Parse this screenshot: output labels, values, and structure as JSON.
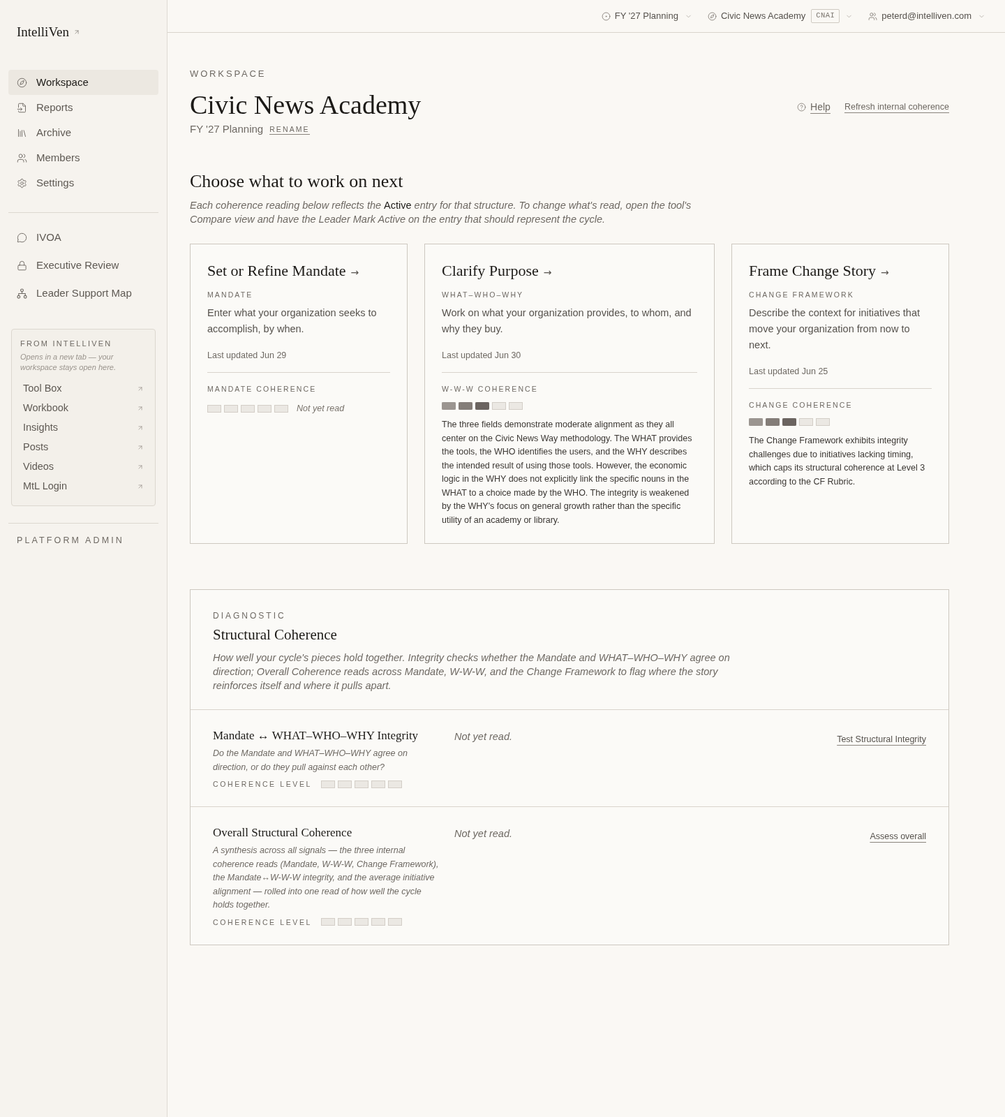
{
  "topbar": {
    "cycle": "FY '27 Planning",
    "org": {
      "name": "Civic News Academy",
      "code": "CNAI"
    },
    "user": "peterd@intelliven.com"
  },
  "sidebar": {
    "logo": "IntelliVen",
    "nav": [
      {
        "label": "Workspace",
        "selected": true
      },
      {
        "label": "Reports",
        "selected": false
      },
      {
        "label": "Archive",
        "selected": false
      },
      {
        "label": "Members",
        "selected": false
      },
      {
        "label": "Settings",
        "selected": false
      }
    ],
    "tools": [
      {
        "label": "IVOA",
        "selected": false
      },
      {
        "label": "Executive Review",
        "selected": false
      },
      {
        "label": "Leader Support Map",
        "selected": false
      }
    ],
    "external": {
      "title": "FROM INTELLIVEN",
      "note": "Opens in a new tab — your workspace stays open here.",
      "links": [
        "Tool Box",
        "Workbook",
        "Insights",
        "Posts",
        "Videos",
        "MtL Login"
      ]
    },
    "admin": "PLATFORM ADMIN"
  },
  "header": {
    "eyebrow": "WORKSPACE",
    "title": "Civic News Academy",
    "cycle": "FY '27 Planning",
    "rename": "RENAME",
    "help": "Help",
    "refresh": "Refresh internal coherence"
  },
  "next": {
    "title": "Choose what to work on next",
    "intro": "Each coherence reading below reflects the **Active** entry for that structure. To change what's read, open the tool's Compare view and have the Leader Mark Active on the entry that should represent the cycle.",
    "cards": [
      {
        "title": "Set or Refine Mandate",
        "arrow": "→",
        "eyebrow": "MANDATE",
        "description": "Enter what your organization seeks to accomplish, by when.",
        "updated": "Last updated Jun 29",
        "coherence": {
          "label": "MANDATE COHERENCE",
          "status": "Not yet read"
        }
      },
      {
        "title": "Clarify Purpose",
        "arrow": "→",
        "eyebrow": "WHAT–WHO–WHY",
        "description": "Work on what your organization provides, to whom, and why they buy.",
        "updated": "Last updated Jun 30",
        "coherence": {
          "label": "W-W-W COHERENCE",
          "level": 0.6,
          "summary": "The three fields demonstrate moderate alignment as they all center on the Civic News Way methodology. The WHAT provides the tools, the WHO identifies the users, and the WHY describes the intended result of using those tools. However, the economic logic in the WHY does not explicitly link the specific nouns in the WHAT to a choice made by the WHO. The integrity is weakened by the WHY's focus on general growth rather than the specific utility of an academy or library."
        }
      },
      {
        "title": "Frame Change Story",
        "arrow": "→",
        "eyebrow": "CHANGE FRAMEWORK",
        "description": "Describe the context for initiatives that move your organization from now to next.",
        "updated": "Last updated Jun 25",
        "coherence": {
          "label": "CHANGE COHERENCE",
          "level": 0.6,
          "summary": "The Change Framework exhibits integrity challenges due to initiatives lacking timing, which caps its structural coherence at Level 3 according to the CF Rubric."
        }
      }
    ]
  },
  "diagnostic": {
    "eyebrow": "DIAGNOSTIC",
    "title": "Structural Coherence",
    "description": "How well your cycle's pieces hold together. Integrity checks whether the Mandate and WHAT–WHO–WHY agree on direction; Overall Coherence reads across Mandate, W-W-W, and the Change Framework to flag where the story reinforces itself and where it pulls apart.",
    "rows": [
      {
        "title": "Mandate ↔ WHAT–WHO–WHY Integrity",
        "description": "Do the Mandate and WHAT–WHO–WHY agree on direction, or do they pull against each other?",
        "level_label": "COHERENCE LEVEL",
        "result": "Not yet read.",
        "action": "Test Structural Integrity"
      },
      {
        "title": "Overall Structural Coherence",
        "description": "A synthesis across all signals — the three internal coherence reads (Mandate, W-W-W, Change Framework), the Mandate↔W-W-W integrity, and the average initiative alignment — rolled into one read of how well the cycle holds together.",
        "level_label": "COHERENCE LEVEL",
        "result": "Not yet read.",
        "action": "Assess overall"
      }
    ]
  }
}
